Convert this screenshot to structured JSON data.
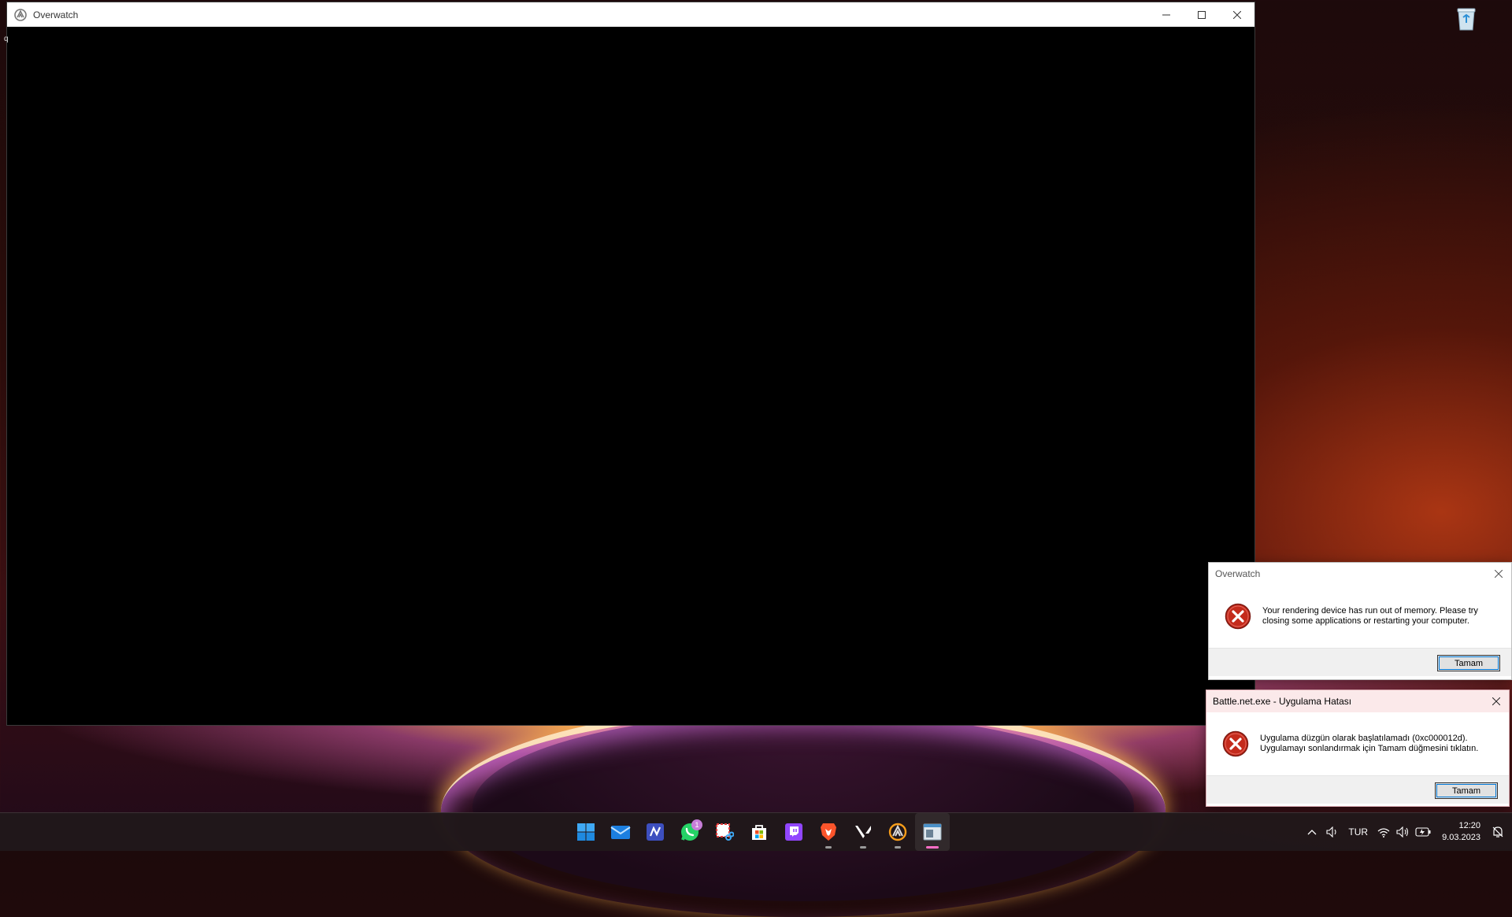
{
  "window": {
    "title": "Overwatch",
    "stray_char": "q"
  },
  "dialog_overwatch": {
    "title": "Overwatch",
    "message_line1": "Your rendering device has run out of memory.  Please try",
    "message_line2": "closing some applications or restarting your computer.",
    "ok_label": "Tamam"
  },
  "dialog_battlenet": {
    "title": "Battle.net.exe - Uygulama Hatası",
    "message_line1": "Uygulama düzgün olarak başlatılamadı (0xc000012d).",
    "message_line2": "Uygulamayı sonlandırmak için Tamam düğmesini tıklatın.",
    "ok_label": "Tamam"
  },
  "taskbar": {
    "apps": [
      {
        "name": "start-icon"
      },
      {
        "name": "mail-icon"
      },
      {
        "name": "notes-app-icon"
      },
      {
        "name": "whatsapp-icon",
        "badge": "1"
      },
      {
        "name": "snipping-tool-icon"
      },
      {
        "name": "microsoft-store-icon"
      },
      {
        "name": "twitch-icon"
      },
      {
        "name": "brave-browser-icon"
      },
      {
        "name": "valorant-icon"
      },
      {
        "name": "overwatch-icon"
      },
      {
        "name": "active-window-icon"
      }
    ],
    "tray": {
      "language": "TUR",
      "time": "12:20",
      "date": "9.03.2023"
    }
  },
  "colors": {
    "accent": "#0078d7",
    "error_red": "#c42b1c",
    "taskbar_bg": "#20181a"
  }
}
